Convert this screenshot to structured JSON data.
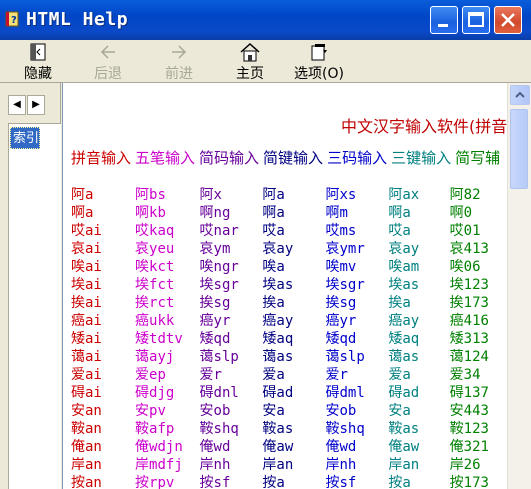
{
  "window": {
    "title": "HTML Help"
  },
  "toolbar": {
    "hide": "隐藏",
    "back": "后退",
    "forward": "前进",
    "home": "主页",
    "options": "选项(O)"
  },
  "nav": {
    "index_tab": "索引"
  },
  "content": {
    "heading": "中文汉字输入软件(拼音",
    "categories": [
      "拼音输入",
      "五笔输入",
      "简码输入",
      "简键输入",
      "三码输入",
      "三键输入",
      "简写辅"
    ],
    "category_colors": [
      "#cc0000",
      "#cc00cc",
      "#660099",
      "#000080",
      "#0000cc",
      "#008080",
      "#008000"
    ],
    "rows": [
      [
        "阿a",
        "阿bs",
        "阿x",
        "阿a",
        "阿xs",
        "阿ax",
        "阿82"
      ],
      [
        "啊a",
        "啊kb",
        "啊ng",
        "啊a",
        "啊m",
        "啊a",
        "啊0"
      ],
      [
        "哎ai",
        "哎kaq",
        "哎nar",
        "哎a",
        "哎ms",
        "哎a",
        "哎01"
      ],
      [
        "哀ai",
        "哀yeu",
        "哀ym",
        "哀ay",
        "哀ymr",
        "哀ay",
        "哀413"
      ],
      [
        "唉ai",
        "唉kct",
        "唉ngr",
        "唉a",
        "唉mv",
        "唉am",
        "唉06"
      ],
      [
        "埃ai",
        "埃fct",
        "埃sgr",
        "埃as",
        "埃sgr",
        "埃as",
        "埃123"
      ],
      [
        "挨ai",
        "挨rct",
        "挨sg",
        "挨a",
        "挨sg",
        "挨a",
        "挨173"
      ],
      [
        "癌ai",
        "癌ukk",
        "癌yr",
        "癌ay",
        "癌yr",
        "癌ay",
        "癌416"
      ],
      [
        "矮ai",
        "矮tdtv",
        "矮qd",
        "矮aq",
        "矮qd",
        "矮aq",
        "矮313"
      ],
      [
        "蔼ai",
        "蔼ayj",
        "蔼slp",
        "蔼as",
        "蔼slp",
        "蔼as",
        "蔼124"
      ],
      [
        "爱ai",
        "爱ep",
        "爱r",
        "爱a",
        "爱r",
        "爱a",
        "爱34"
      ],
      [
        "碍ai",
        "碍djg",
        "碍dnl",
        "碍ad",
        "碍dml",
        "碍ad",
        "碍137"
      ],
      [
        "安an",
        "安pv",
        "安ob",
        "安a",
        "安ob",
        "安a",
        "安443"
      ],
      [
        "鞍an",
        "鞍afp",
        "鞍shq",
        "鞍as",
        "鞍shq",
        "鞍as",
        "鞍123"
      ],
      [
        "俺an",
        "俺wdjn",
        "俺wd",
        "俺aw",
        "俺wd",
        "俺aw",
        "俺321"
      ],
      [
        "岸an",
        "岸mdfj",
        "岸nh",
        "岸an",
        "岸nh",
        "岸an",
        "岸26"
      ],
      [
        "按an",
        "按rpv",
        "按sf",
        "按a",
        "按sf",
        "按a",
        "按173"
      ]
    ]
  }
}
